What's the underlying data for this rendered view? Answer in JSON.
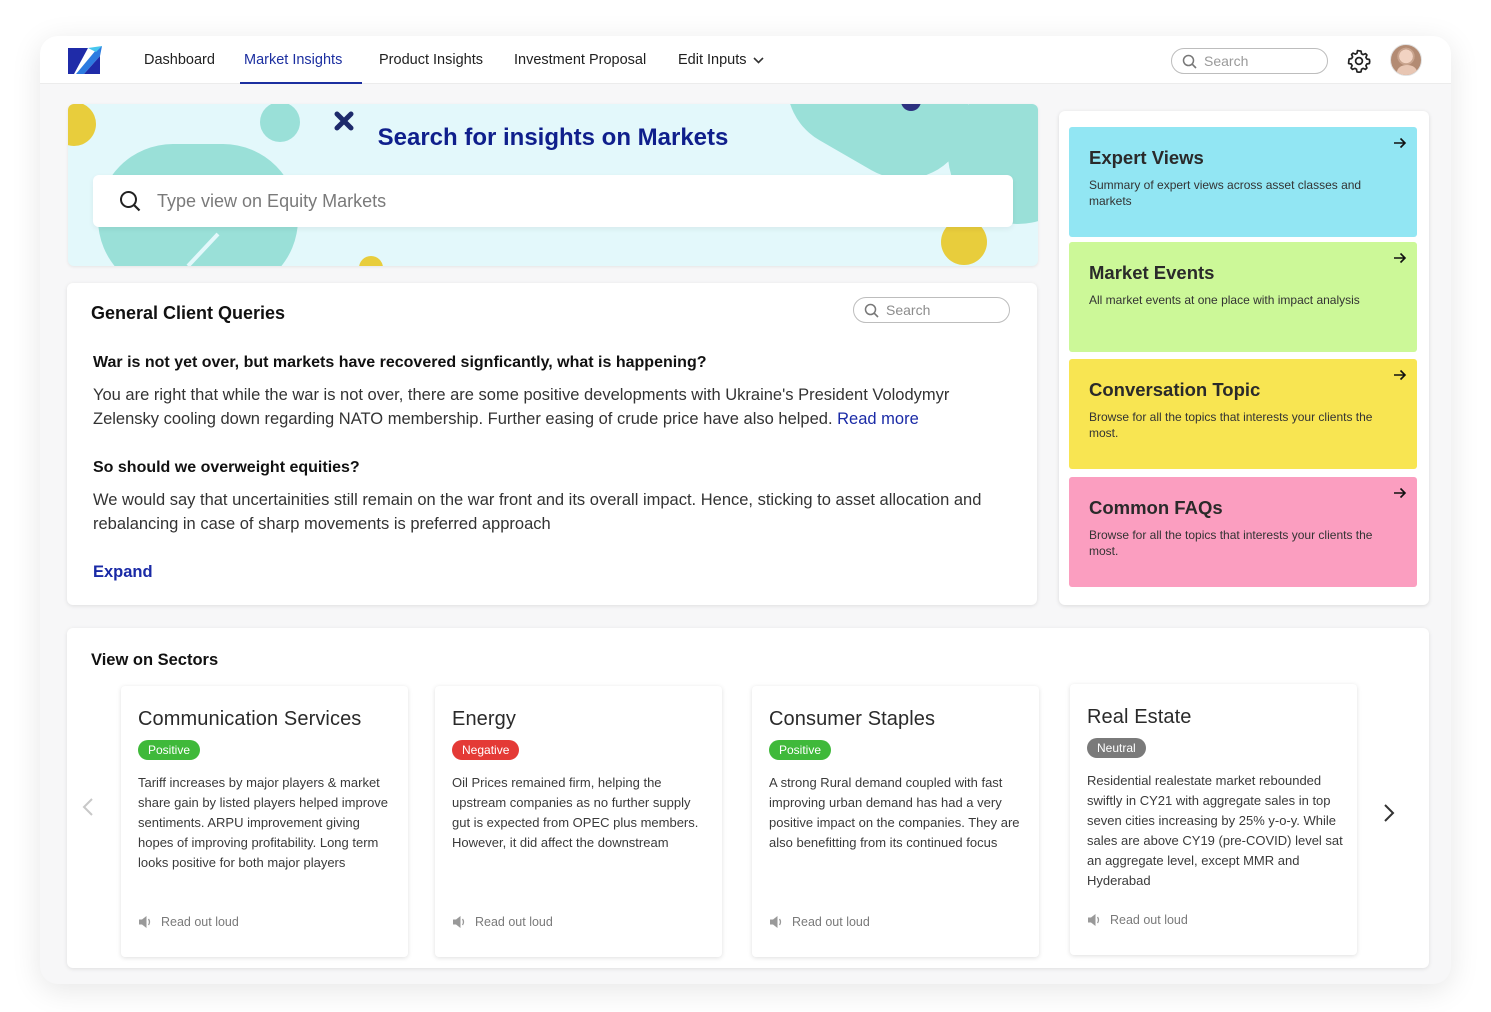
{
  "nav": {
    "items": [
      {
        "label": "Dashboard"
      },
      {
        "label": "Market Insights"
      },
      {
        "label": "Product Insights"
      },
      {
        "label": "Investment Proposal"
      },
      {
        "label": "Edit Inputs"
      }
    ],
    "active": "Market Insights",
    "search_placeholder": "Search"
  },
  "hero": {
    "title": "Search for insights on Markets",
    "placeholder": "Type view on Equity Markets"
  },
  "queries": {
    "title": "General Client Queries",
    "search_placeholder": "Search",
    "items": [
      {
        "question": "War is not yet over, but markets have recovered signficantly, what is happening?",
        "answer": "You are right that while the war is not over, there are some positive developments with Ukraine's President Volodymyr Zelensky cooling down regarding NATO membership. Further easing of crude price have also helped.",
        "link": "Read more"
      },
      {
        "question": "So should we overweight equities?",
        "answer": "We would say that uncertainities still remain on the war front and its overall impact. Hence, sticking to asset allocation and rebalancing in case of sharp movements is preferred approach"
      }
    ],
    "expand_label": "Expand"
  },
  "tiles": [
    {
      "title": "Expert Views",
      "desc": "Summary of expert views across asset classes and markets",
      "color": "#92e6f3"
    },
    {
      "title": "Market Events",
      "desc": "All market events at one place with impact analysis",
      "color": "#ccf898"
    },
    {
      "title": "Conversation Topic",
      "desc": "Browse for all the topics that interests your clients the most.",
      "color": "#f8e552"
    },
    {
      "title": "Common FAQs",
      "desc": "Browse for all the topics that interests your clients the most.",
      "color": "#fb9ec0"
    }
  ],
  "sectors": {
    "title": "View on Sectors",
    "read_label": "Read out loud",
    "cards": [
      {
        "name": "Communication Services",
        "sentiment": "Positive",
        "sentiment_color": "#3fb93a",
        "text": "Tariff increases by major players & market share gain by listed players helped improve sentiments. ARPU improvement giving hopes of improving profitability. Long term looks positive for both major players"
      },
      {
        "name": "Energy",
        "sentiment": "Negative",
        "sentiment_color": "#e43a36",
        "text": "Oil Prices remained firm, helping the upstream companies as no further supply gut is expected from OPEC plus members. However, it did affect the downstream"
      },
      {
        "name": "Consumer Staples",
        "sentiment": "Positive",
        "sentiment_color": "#3fb93a",
        "text": "A strong Rural demand coupled with fast improving urban demand has had a very positive impact on the companies. They are also benefitting from its continued focus"
      },
      {
        "name": "Real Estate",
        "sentiment": "Neutral",
        "sentiment_color": "#7a7a7a",
        "text": "Residential realestate market rebounded swiftly in CY21 with aggregate sales in top seven cities increasing by 25% y-o-y. While sales are above CY19 (pre-COVID) level sat an aggregate level, except MMR and Hyderabad"
      }
    ]
  }
}
